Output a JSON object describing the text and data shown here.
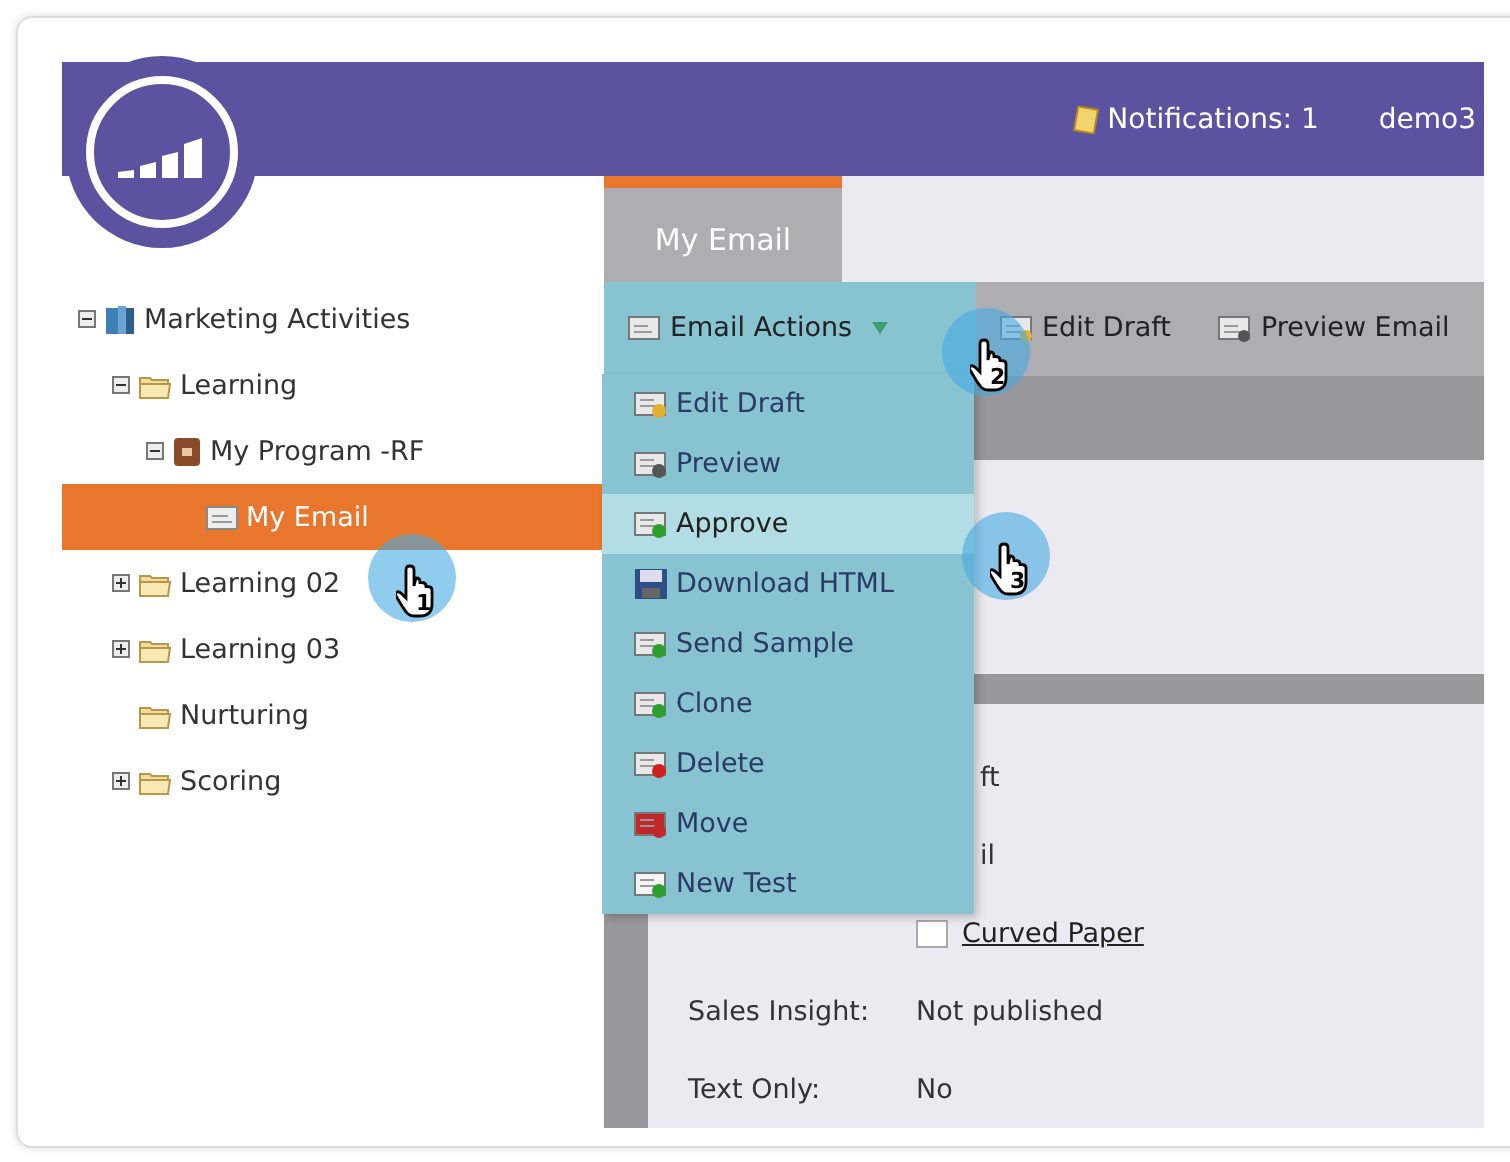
{
  "header": {
    "notifications": "Notifications: 1",
    "user": "demo3"
  },
  "tree": [
    {
      "label": "Marketing Activities",
      "kind": "activities",
      "expanded": true,
      "selected": false,
      "children": [
        {
          "label": "Learning",
          "kind": "folder",
          "expanded": true,
          "selected": false,
          "children": [
            {
              "label": "My Program -RF",
              "kind": "program",
              "expanded": true,
              "selected": false,
              "children": [
                {
                  "label": "My Email",
                  "kind": "email",
                  "selected": true
                }
              ]
            }
          ]
        },
        {
          "label": "Learning 02",
          "kind": "folder",
          "expanded": false,
          "selected": false
        },
        {
          "label": "Learning 03",
          "kind": "folder",
          "expanded": false,
          "selected": false
        },
        {
          "label": "Nurturing",
          "kind": "folder",
          "selected": false
        },
        {
          "label": "Scoring",
          "kind": "folder",
          "expanded": false,
          "selected": false
        }
      ]
    }
  ],
  "tab": {
    "label": "My Email",
    "selected": true
  },
  "toolbar": [
    {
      "label": "Email Actions",
      "kind": "email",
      "active": true,
      "dropdown": true
    },
    {
      "label": "Edit Draft",
      "kind": "edit",
      "active": false,
      "dropdown": false
    },
    {
      "label": "Preview Email",
      "kind": "preview",
      "active": false,
      "dropdown": false
    }
  ],
  "menu": [
    {
      "label": "Edit Draft",
      "kind": "edit",
      "selected": false
    },
    {
      "label": "Preview",
      "kind": "preview",
      "selected": false
    },
    {
      "label": "Approve",
      "kind": "approve",
      "selected": true
    },
    {
      "label": "Download HTML",
      "kind": "download",
      "selected": false
    },
    {
      "label": "Send Sample",
      "kind": "send",
      "selected": false
    },
    {
      "label": "Clone",
      "kind": "clone",
      "selected": false
    },
    {
      "label": "Delete",
      "kind": "delete",
      "selected": false
    },
    {
      "label": "Move",
      "kind": "move",
      "selected": false
    },
    {
      "label": "New Test",
      "kind": "test",
      "selected": false
    }
  ],
  "details": [
    {
      "value": "ft",
      "kind": "fragment"
    },
    {
      "value": "il",
      "kind": "fragment"
    },
    {
      "value": "Curved Paper",
      "kind": "link"
    },
    {
      "label": "Sales Insight:",
      "value": "Not published",
      "kind": "text"
    },
    {
      "label": "Text Only:",
      "value": "No",
      "kind": "text"
    }
  ],
  "cursors": [
    {
      "number": "1"
    },
    {
      "number": "2"
    },
    {
      "number": "3"
    }
  ]
}
